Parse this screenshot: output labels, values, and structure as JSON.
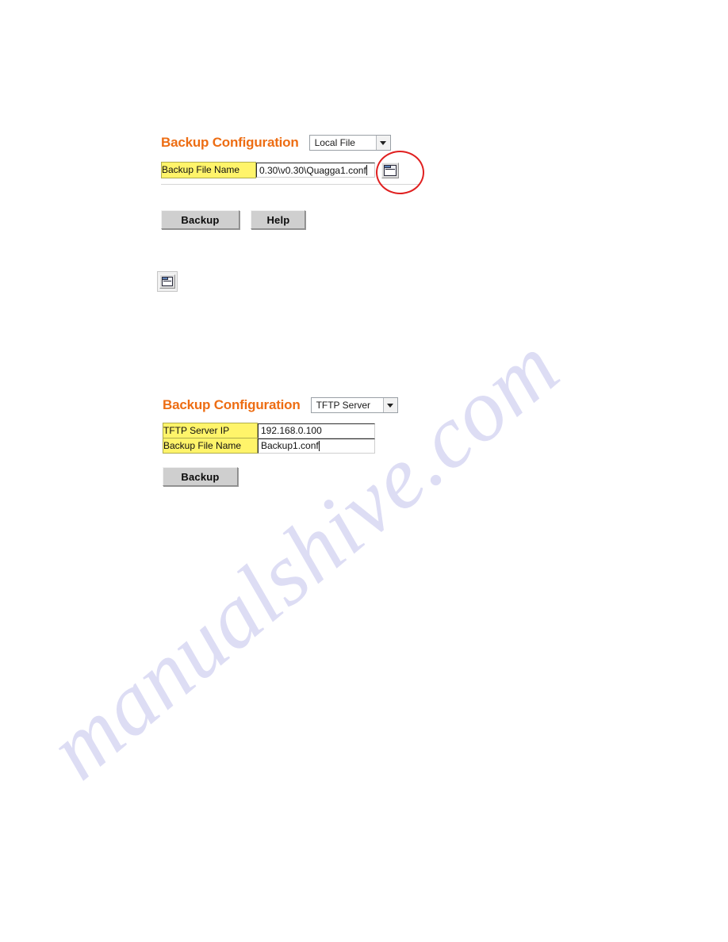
{
  "watermark": {
    "text": "manualshive.com"
  },
  "colors": {
    "heading": "#ED6D13",
    "label_bg": "#FFF46A",
    "button_face": "#CFCFCF",
    "annotation": "#E02020"
  },
  "section_local": {
    "title": "Backup Configuration",
    "mode_select": {
      "value": "Local File",
      "options": [
        "Local File",
        "TFTP Server"
      ],
      "arrow_icon": "chevron-down-icon"
    },
    "fields": [
      {
        "label": "Backup File Name",
        "value": "0.30\\v0.30\\Quagga1.conf",
        "placeholder": "",
        "has_browse": true,
        "browse_icon": "folder-browse-icon"
      }
    ],
    "buttons": [
      {
        "label": "Backup"
      },
      {
        "label": "Help"
      }
    ]
  },
  "icon_sample": {
    "name": "folder-browse-icon",
    "caption": ""
  },
  "section_tftp": {
    "title": "Backup Configuration",
    "mode_select": {
      "value": "TFTP Server",
      "options": [
        "Local File",
        "TFTP Server"
      ],
      "arrow_icon": "chevron-down-icon"
    },
    "fields": [
      {
        "label": "TFTP Server IP",
        "value": "192.168.0.100",
        "placeholder": "",
        "has_browse": false
      },
      {
        "label": "Backup File Name",
        "value": "Backup1.conf",
        "placeholder": "",
        "has_browse": false
      }
    ],
    "buttons": [
      {
        "label": "Backup"
      }
    ]
  }
}
